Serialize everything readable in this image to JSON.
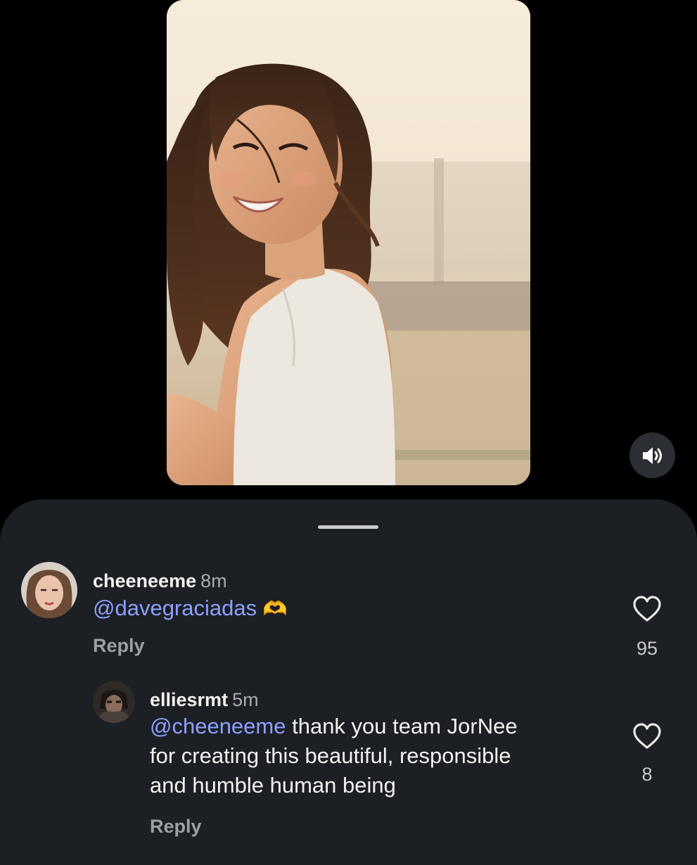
{
  "video": {
    "sound_icon": "speaker-sound-on-icon"
  },
  "comments": [
    {
      "username": "cheeneeme",
      "time": "8m",
      "mention": "@davegraciadas",
      "text": "",
      "emoji": "🫶",
      "reply_label": "Reply",
      "likes": "95"
    },
    {
      "username": "elliesrmt",
      "time": "5m",
      "mention": "@cheeneeme",
      "text_line1": " thank you team JorNee",
      "text_line2": "for creating this beautiful, responsible",
      "text_line3": "and humble human being",
      "reply_label": "Reply",
      "likes": "8"
    }
  ],
  "colors": {
    "background": "#000000",
    "sheet": "#1c1f24",
    "mention": "#8ea0ff",
    "secondary_text": "#9c9fa5"
  }
}
